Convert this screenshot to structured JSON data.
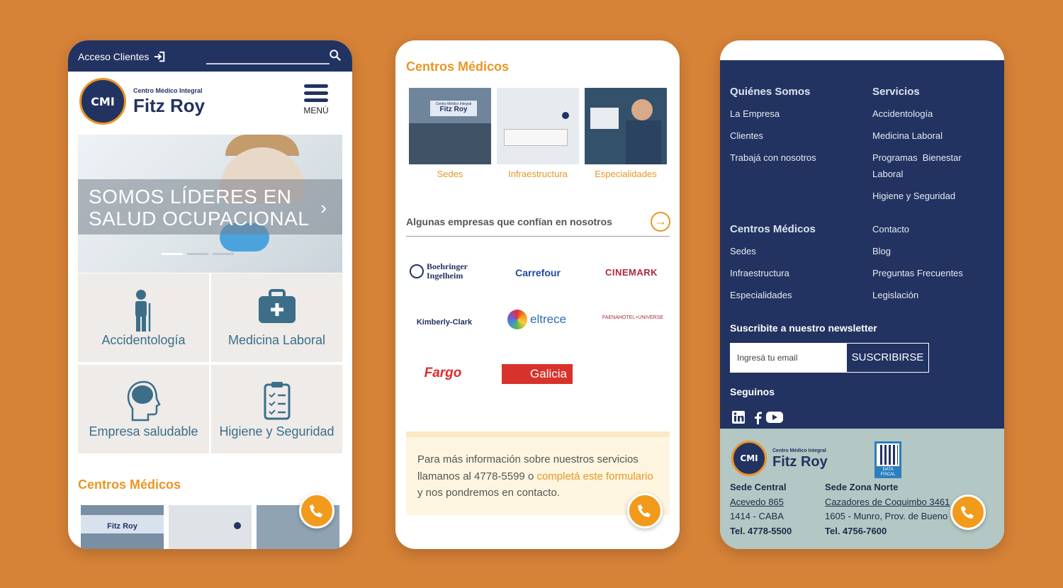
{
  "phone1": {
    "acceso_label": "Acceso Clientes",
    "logo_small": "Centro Médico Integral",
    "logo_big": "Fitz Roy",
    "logo_mark": "CMI",
    "menu_label": "MENÚ",
    "hero_title_line1": "SOMOS LÍDERES EN",
    "hero_title_line2": "SALUD OCUPACIONAL",
    "tiles": [
      {
        "label": "Accidentología",
        "icon": "person-crutch-icon"
      },
      {
        "label": "Medicina Laboral",
        "icon": "medical-kit-icon"
      },
      {
        "label": "Empresa saludable",
        "icon": "head-brain-icon"
      },
      {
        "label": "Higiene y Seguridad",
        "icon": "clipboard-checklist-icon"
      }
    ],
    "centros_title": "Centros Médicos",
    "thumb_sign": "Fitz Roy"
  },
  "phone2": {
    "centros_title": "Centros Médicos",
    "centros": [
      {
        "label": "Sedes"
      },
      {
        "label": "Infraestructura"
      },
      {
        "label": "Especialidades"
      }
    ],
    "sign_small": "Centro Médico Integral",
    "sign_big": "Fitz Roy",
    "empresas_title": "Algunas empresas que confían en nosotros",
    "brands": [
      {
        "name": "Boehringer Ingelheim"
      },
      {
        "name": "Carrefour"
      },
      {
        "name": "CINEMARK"
      },
      {
        "name": "Kimberly-Clark"
      },
      {
        "name": "eltrece"
      },
      {
        "name": "FAENAHOTEL+UNIVERSE"
      },
      {
        "name": "Fargo"
      },
      {
        "name": "Galicia"
      }
    ],
    "info_text_1": "Para más información sobre nuestros servicios llamanos al 4778-5599 o ",
    "info_link": "completá este formulario",
    "info_text_2": " y nos pondremos en contacto."
  },
  "phone3": {
    "quienes_title": "Quiénes Somos",
    "quienes_links": [
      "La Empresa",
      "Clientes",
      "Trabajá con nosotros"
    ],
    "servicios_title": "Servicios",
    "servicios_links": [
      "Accidentología",
      "Medicina Laboral",
      "Programas  Bienestar",
      "Laboral",
      "Higiene y Seguridad"
    ],
    "centros_title": "Centros Médicos",
    "centros_links": [
      "Sedes",
      "Infraestructura",
      "Especialidades"
    ],
    "extra_links": [
      "Contacto",
      "Blog",
      "Preguntas Frecuentes",
      "Legislación"
    ],
    "newsletter_title": "Suscribite a nuestro newsletter",
    "newsletter_placeholder": "Ingresá tu email",
    "newsletter_button": "SUSCRIBIRSE",
    "seguinos_title": "Seguinos",
    "logo_small": "Centro Médico Integral",
    "logo_big": "Fitz Roy",
    "logo_mark": "CMI",
    "qr_label": "DATA FISCAL",
    "sede_central": {
      "title": "Sede Central",
      "street": "Acevedo 865",
      "city": "1414 - CABA",
      "tel": "Tel. 4778-5500"
    },
    "sede_norte": {
      "title": "Sede Zona Norte",
      "street": "Cazadores de Coquimbo 3461",
      "city": "1605 - Munro, Prov. de Bueno",
      "tel": "Tel. 4756-7600"
    }
  },
  "colors": {
    "background": "#d68237",
    "navy": "#223361",
    "accent": "#e99625",
    "teal_text": "#3c6e8a",
    "footer_light": "#b3c7c4",
    "whatsapp": "#f29a1c"
  }
}
